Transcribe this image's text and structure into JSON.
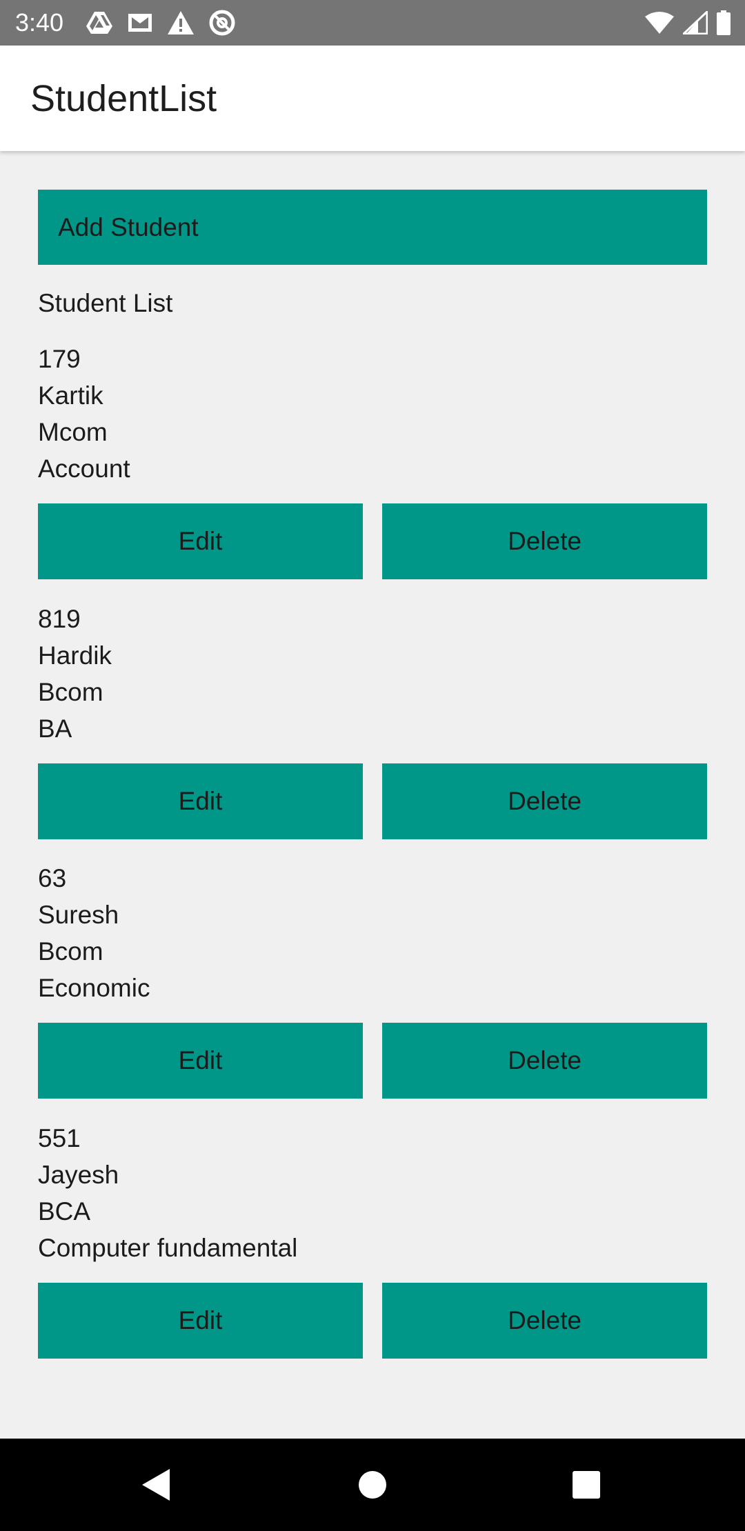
{
  "status_bar": {
    "time": "3:40",
    "left_icons": [
      "drive-icon",
      "gmail-icon",
      "warning-icon",
      "at-sign-icon"
    ],
    "right_icons": [
      "wifi-icon",
      "signal-icon",
      "battery-icon"
    ]
  },
  "app_bar": {
    "title": "StudentList"
  },
  "main": {
    "add_button_label": "Add Student",
    "list_heading": "Student List",
    "students": [
      {
        "id": "179",
        "name": "Kartik",
        "course": "Mcom",
        "subject": "Account",
        "edit_label": "Edit",
        "delete_label": "Delete"
      },
      {
        "id": "819",
        "name": "Hardik",
        "course": "Bcom",
        "subject": "BA",
        "edit_label": "Edit",
        "delete_label": "Delete"
      },
      {
        "id": "63",
        "name": "Suresh",
        "course": "Bcom",
        "subject": "Economic",
        "edit_label": "Edit",
        "delete_label": "Delete"
      },
      {
        "id": "551",
        "name": "Jayesh",
        "course": "BCA",
        "subject": "Computer fundamental",
        "edit_label": "Edit",
        "delete_label": "Delete"
      }
    ]
  },
  "nav_bar": {
    "icons": [
      "back-icon",
      "home-icon",
      "recents-icon"
    ]
  },
  "colors": {
    "accent": "#009688",
    "status_bar": "#757575",
    "app_bar": "#ffffff",
    "background": "#f0f0f0",
    "nav_bar": "#000000"
  }
}
